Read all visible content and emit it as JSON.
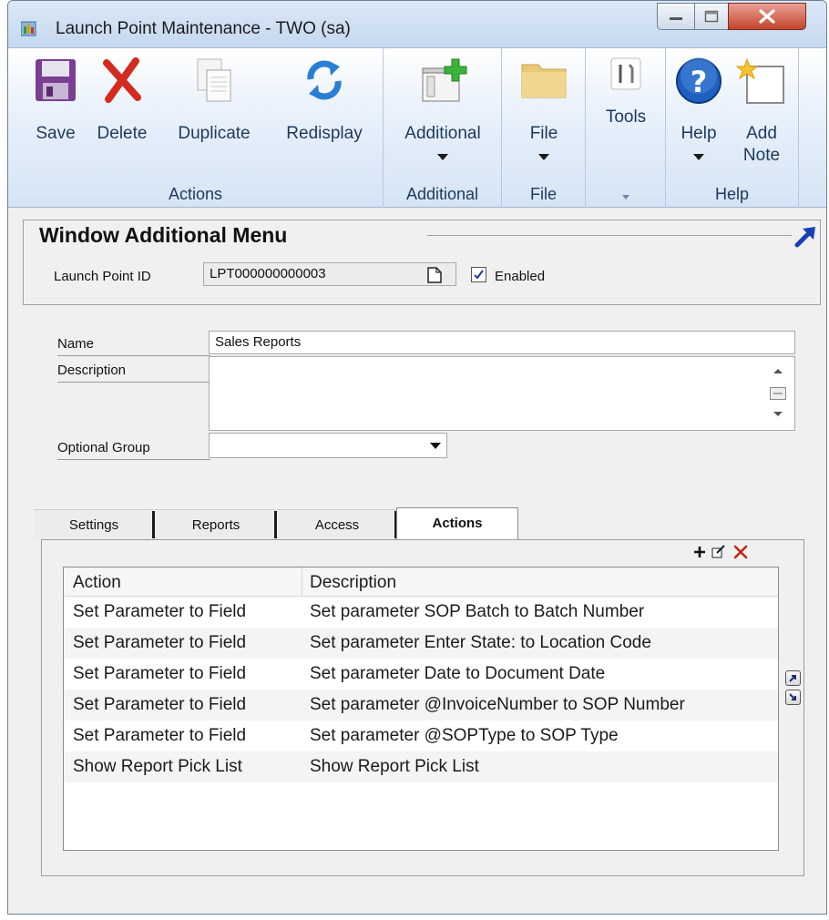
{
  "window": {
    "title": "Launch Point Maintenance  -  TWO (sa)"
  },
  "ribbon": {
    "groups": {
      "actions": {
        "label": "Actions",
        "buttons": {
          "save": "Save",
          "delete": "Delete",
          "duplicate": "Duplicate",
          "redisplay": "Redisplay"
        }
      },
      "additional": {
        "label": "Additional",
        "button": "Additional"
      },
      "file": {
        "label": "File",
        "button": "File"
      },
      "tools": {
        "button": "Tools"
      },
      "help": {
        "label": "Help",
        "help_button": "Help",
        "add_note_line1": "Add",
        "add_note_line2": "Note"
      }
    }
  },
  "header": {
    "title": "Window Additional Menu",
    "launch_point_label": "Launch Point ID",
    "launch_point_value": "LPT000000000003",
    "enabled_label": "Enabled",
    "enabled_checked": true
  },
  "form": {
    "name_label": "Name",
    "name_value": "Sales Reports",
    "description_label": "Description",
    "description_value": "",
    "optional_group_label": "Optional Group",
    "optional_group_value": ""
  },
  "tabs": [
    {
      "label": "Settings"
    },
    {
      "label": "Reports"
    },
    {
      "label": "Access"
    },
    {
      "label": "Actions",
      "active": true
    }
  ],
  "grid": {
    "columns": [
      "Action",
      "Description"
    ],
    "rows": [
      {
        "action": "Set Parameter to Field",
        "description": "Set parameter SOP Batch to Batch Number"
      },
      {
        "action": "Set Parameter to Field",
        "description": "Set parameter Enter State: to Location Code"
      },
      {
        "action": "Set Parameter to Field",
        "description": "Set parameter Date to Document Date"
      },
      {
        "action": "Set Parameter to Field",
        "description": "Set parameter @InvoiceNumber to SOP Number"
      },
      {
        "action": "Set Parameter to Field",
        "description": "Set parameter @SOPType to SOP Type"
      },
      {
        "action": "Show Report Pick List",
        "description": "Show Report Pick List"
      }
    ]
  },
  "icons": {
    "colors": {
      "save": "#7a3f91",
      "delete": "#d42a1f",
      "redisplay": "#2a7fd4",
      "help": "#1f5fbf",
      "add": "#3cb43c"
    }
  }
}
